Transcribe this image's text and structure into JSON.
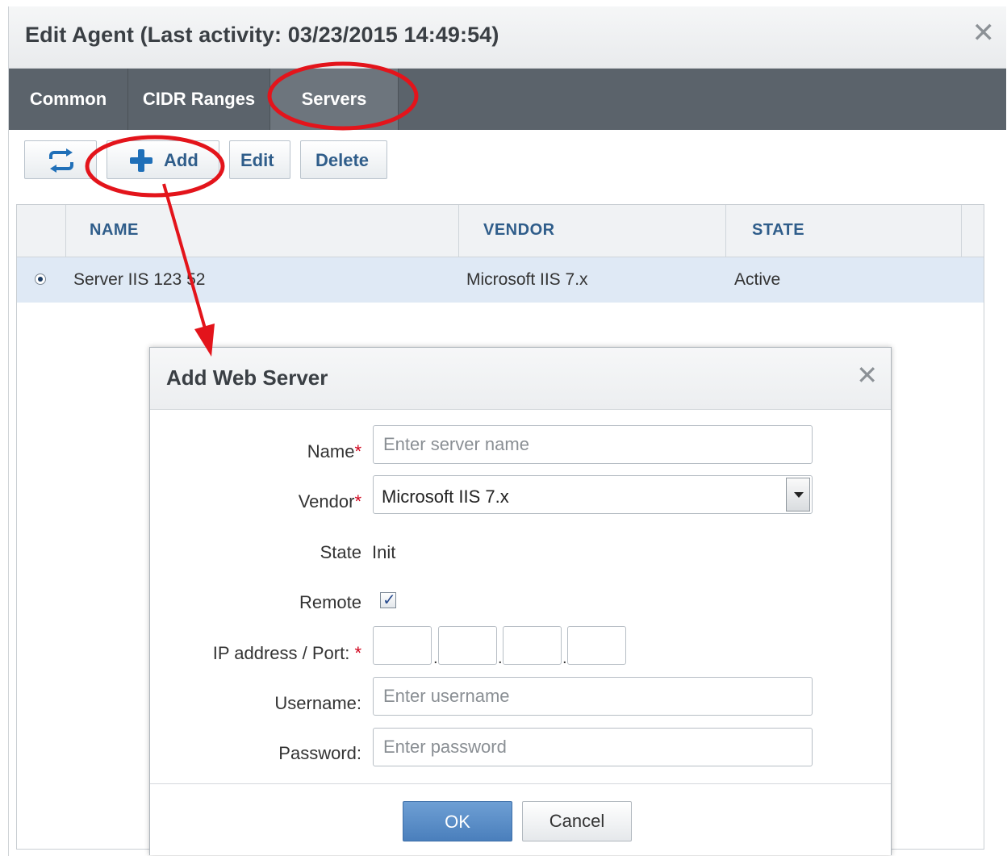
{
  "edit_dialog": {
    "title": "Edit Agent (Last activity: 03/23/2015 14:49:54)",
    "close_glyph": "✕",
    "tabs": [
      {
        "label": "Common",
        "active": false
      },
      {
        "label": "CIDR Ranges",
        "active": false
      },
      {
        "label": "Servers",
        "active": true
      }
    ],
    "toolbar": {
      "refresh_icon": "refresh-icon",
      "add_label": "Add",
      "edit_label": "Edit",
      "delete_label": "Delete"
    },
    "grid": {
      "columns": [
        "NAME",
        "VENDOR",
        "STATE"
      ],
      "rows": [
        {
          "name": "Server IIS 123 52",
          "vendor": "Microsoft IIS 7.x",
          "state": "Active",
          "selected": true
        }
      ]
    }
  },
  "add_dialog": {
    "title": "Add Web Server",
    "close_glyph": "✕",
    "fields": {
      "name_label": "Name",
      "name_placeholder": "Enter server name",
      "vendor_label": "Vendor",
      "vendor_value": "Microsoft IIS 7.x",
      "state_label": "State",
      "state_value": "Init",
      "remote_label": "Remote",
      "remote_checked": true,
      "ip_label": "IP address / Port:",
      "username_label": "Username:",
      "username_placeholder": "Enter username",
      "password_label": "Password:",
      "password_placeholder": "Enter password",
      "required_mark": "*"
    },
    "ok_label": "OK",
    "cancel_label": "Cancel"
  },
  "colors": {
    "tab_bar": "#5b636b",
    "selected_row": "#dfe9f5",
    "ok_button": "#5a8ec8",
    "annotation": "#e3141b",
    "required": "#d0021b"
  }
}
